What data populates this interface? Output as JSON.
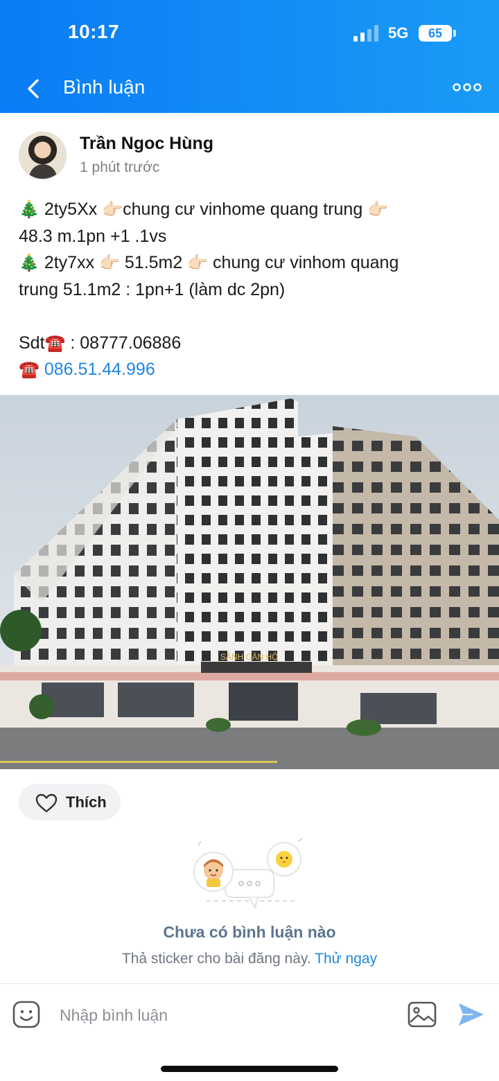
{
  "status_bar": {
    "time": "10:17",
    "network": "5G",
    "battery": "65"
  },
  "header": {
    "title": "Bình luận"
  },
  "post": {
    "author": "Trần Ngoc Hùng",
    "time": "1 phút trước",
    "lines": [
      [
        "🎄",
        " 2ty5Xx ",
        "👉🏻",
        "chung cư vinhome quang trung ",
        "👉🏻"
      ],
      "48.3 m.1pn +1 .1vs",
      [
        "🎄",
        "  2ty7xx ",
        "👉🏻",
        " 51.5m2 ",
        "👉🏻",
        " chung cư vinhom quang"
      ],
      "trung 51.1m2 : 1pn+1 (làm dc 2pn)",
      "",
      [
        "Sdt",
        "☎️",
        " : 08777.06886"
      ],
      [
        "☎️",
        " ",
        "086.51.44.996"
      ]
    ],
    "photo_sign": "SẢNH CĂN HỘ"
  },
  "like": {
    "label": "Thích"
  },
  "empty_state": {
    "title": "Chưa có bình luận nào",
    "subtitle": "Thả sticker cho bài đăng này.",
    "action": "Thử ngay"
  },
  "composer": {
    "placeholder": "Nhập bình luận"
  },
  "colors": {
    "header": "#0a7cf5",
    "link": "#1f87e0",
    "send": "#7fb6f2"
  }
}
